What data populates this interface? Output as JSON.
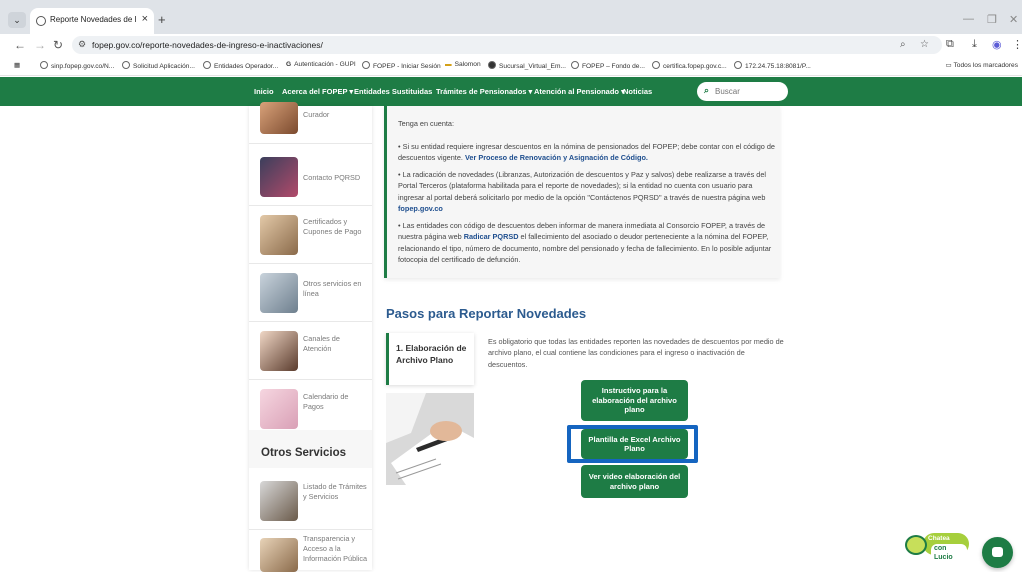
{
  "browser": {
    "tab_title": "Reporte Novedades de Ingreso",
    "tab_close": "×",
    "new_tab": "+",
    "url": "fopep.gov.co/reporte-novedades-de-ingreso-e-inactivaciones/",
    "bookmarks": [
      "sinp.fopep.gov.co/N...",
      "Solicitud Aplicación...",
      "Entidades Operador...",
      "Autenticación - GUPI",
      "FOPEP - Iniciar Sesión",
      "Salomon",
      "Sucursal_Virtual_Em...",
      "FOPEP – Fondo de...",
      "certifica.fopep.gov.c...",
      "172.24.75.18:8081/P..."
    ],
    "all_bookmarks": "Todos los marcadores"
  },
  "site_nav": {
    "items": [
      "Inicio",
      "Acerca del FOPEP ▾",
      "Entidades Sustituidas",
      "Trámites de Pensionados ▾",
      "Atención al Pensionado ▾",
      "Noticias"
    ],
    "search_placeholder": "Buscar"
  },
  "sidebar": {
    "items": [
      {
        "label": "Curador",
        "icon": "people-icon"
      },
      {
        "label": "Contacto PQRSD",
        "icon": "keyboard-icon"
      },
      {
        "label": "Certificados y Cupones de Pago",
        "icon": "people-icon"
      },
      {
        "label": "Otros servicios en línea",
        "icon": "people-icon"
      },
      {
        "label": "Canales de Atención",
        "icon": "headset-icon"
      },
      {
        "label": "Calendario de Pagos",
        "icon": "calendar-icon"
      }
    ],
    "otros_title": "Otros Servicios",
    "otros_items": [
      {
        "label": "Listado de Trámites y Servicios"
      },
      {
        "label": "Transparencia y Acceso a la Información Pública"
      }
    ]
  },
  "info_card": {
    "heading": "Tenga en cuenta:",
    "p1": "•  Si su entidad requiere ingresar descuentos en la nómina de pensionados del FOPEP; debe contar con el código de descuentos vigente.",
    "p1_link": "Ver Proceso de Renovación y Asignación de Código.",
    "p2": "•  La radicación de novedades (Libranzas, Autorización de descuentos y Paz y salvos) debe realizarse a través del Portal Terceros (plataforma habilitada para el reporte de novedades); si la entidad no cuenta con usuario para ingresar al portal deberá solicitarlo por medio de la opción \"Contáctenos PQRSD\" a través de nuestra página web",
    "p2_link": "fopep.gov.co",
    "p3_a": "•  Las entidades con código de descuentos deben informar de manera inmediata al Consorcio FOPEP, a través de nuestra página web",
    "p3_link": "Radicar PQRSD",
    "p3_b": "el fallecimiento del asociado o deudor perteneciente a la nómina del FOPEP, relacionando el tipo, número de documento, nombre del pensionado y fecha de fallecimiento. En lo posible adjuntar fotocopia del certificado de defunción."
  },
  "steps": {
    "title": "Pasos para Reportar Novedades",
    "step1_title": "1. Elaboración de Archivo Plano",
    "step1_desc": "Es obligatorio que todas las entidades reporten las novedades de descuentos por medio de archivo plano, el cual contiene las condiciones para el ingreso o inactivación de descuentos.",
    "buttons": [
      "Instructivo para la elaboración del archivo plano",
      "Plantilla de Excel Archivo Plano",
      "Ver video elaboración del archivo plano"
    ]
  },
  "chat": {
    "line1": "Chatea",
    "line2": "con Lucio"
  },
  "colors": {
    "brand_green": "#1e7c45",
    "title_blue": "#2c5b8f",
    "highlight_blue": "#1565c0"
  }
}
